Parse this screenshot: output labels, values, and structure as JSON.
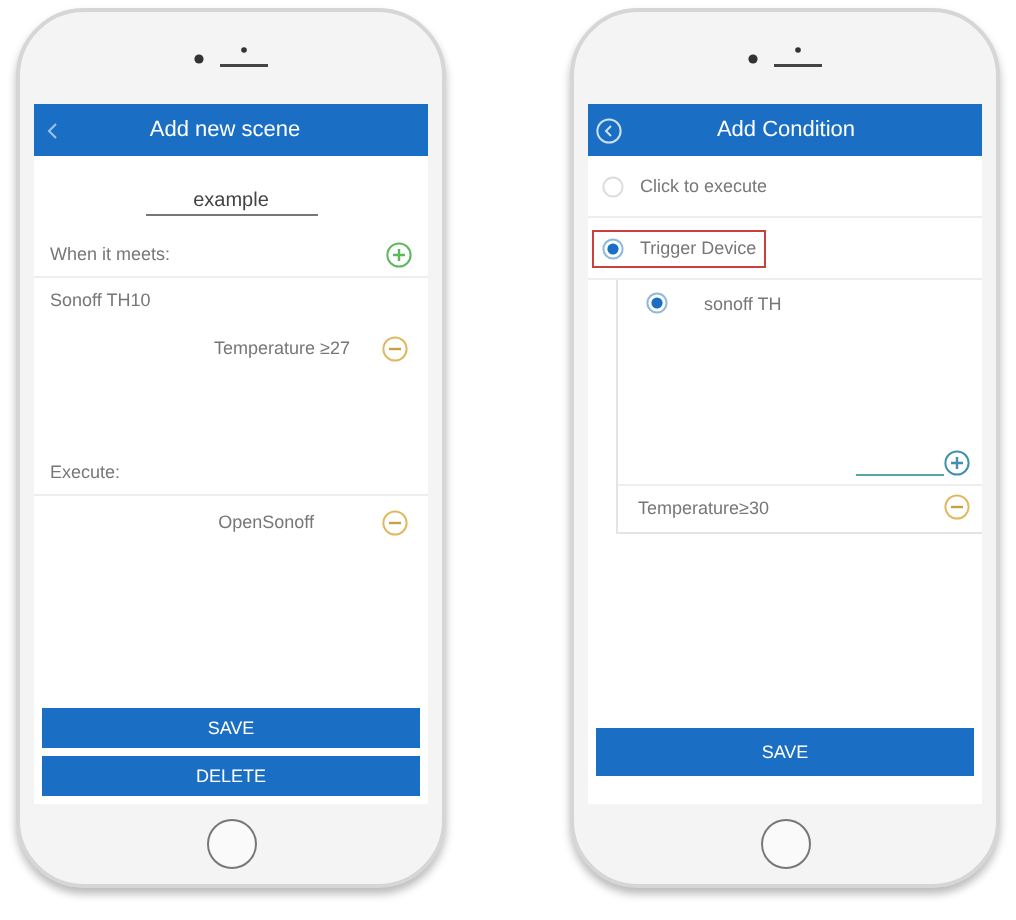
{
  "scene_editor": {
    "title": "Add new scene",
    "name_value": "example",
    "when_label": "When it meets:",
    "trigger_device": "Sonoff TH10",
    "conditions": [
      "Temperature ≥27"
    ],
    "execute_label": "Execute:",
    "actions": [
      "OpenSonoff"
    ],
    "buttons": [
      "SAVE",
      "DELETE"
    ]
  },
  "condition_editor": {
    "title": "Add Condition",
    "options": [
      {
        "label": "Click to execute",
        "selected": false,
        "highlighted": false
      },
      {
        "label": "Trigger Device",
        "selected": true,
        "highlighted": true
      }
    ],
    "devices": [
      {
        "label": "sonoff TH",
        "selected": true
      }
    ],
    "conditions": [
      "Temperature≥30"
    ],
    "buttons": [
      "SAVE"
    ]
  }
}
